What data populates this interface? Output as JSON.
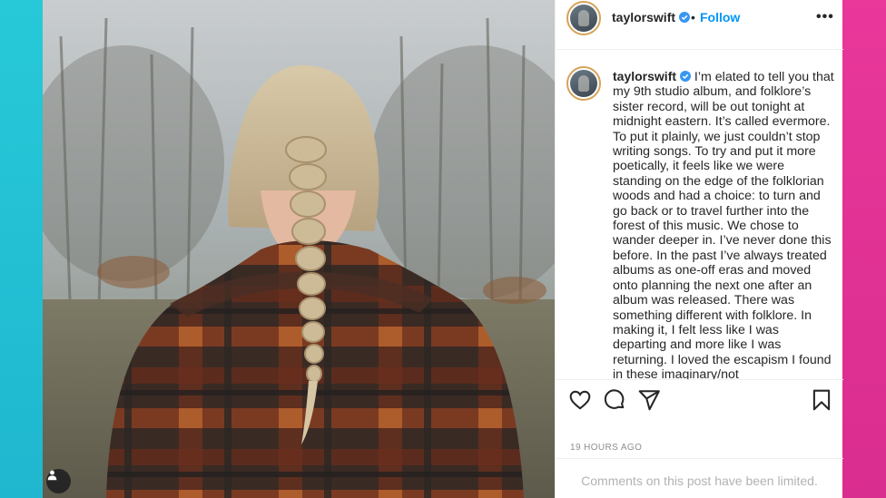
{
  "theme": {
    "accent": "#0095f6",
    "left_bg": "#27c9d8",
    "right_bg": "#e9379a",
    "text": "#262626",
    "muted": "#8e8e8e"
  },
  "header": {
    "username": "taylorswift",
    "separator": "•",
    "follow_label": "Follow",
    "more_icon": "more-options-icon"
  },
  "caption": {
    "username": "taylorswift",
    "text": "I’m elated to tell you that my 9th studio album, and folklore’s sister record, will be out tonight at midnight eastern. It’s called evermore. To put it plainly, we just couldn’t stop writing songs. To try and put it more poetically, it feels like we were standing on the edge of the folklorian woods and had a choice: to turn and go back or to travel further into the forest of this music. We chose to wander deeper in. I’ve never done this before. In the past I’ve always treated albums as one-off eras and moved onto planning the next one after an album was released. There was something different with folklore. In making it, I felt less like I was departing and more like I was returning. I loved the escapism I found in these imaginary/not"
  },
  "actions": [
    "like-icon",
    "comment-icon",
    "share-icon",
    "save-icon"
  ],
  "timestamp": "19 HOURS AGO",
  "comments_notice": "Comments on this post have been limited."
}
